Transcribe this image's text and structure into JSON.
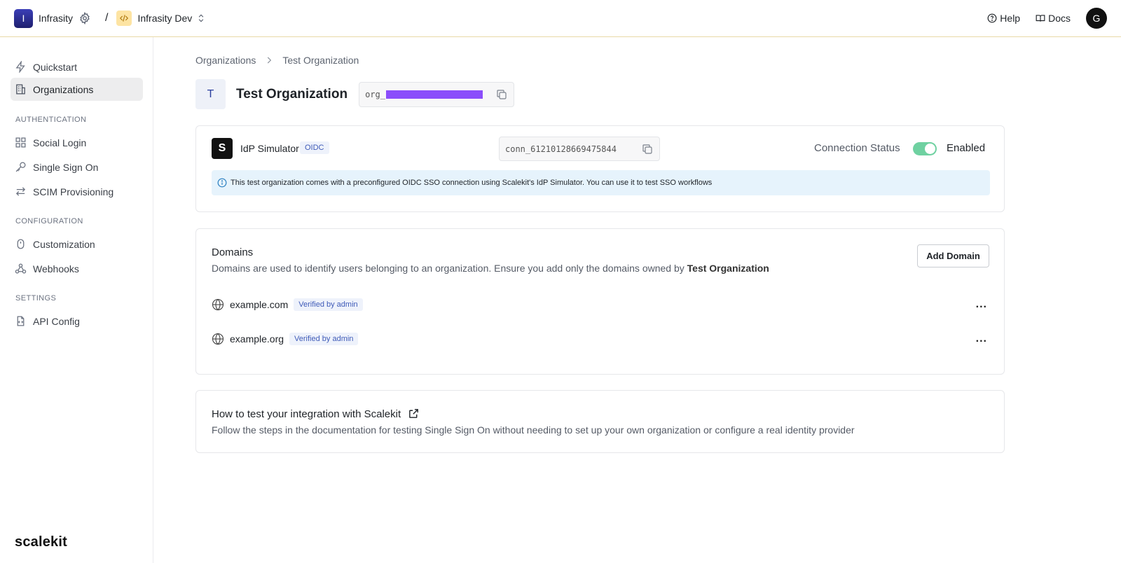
{
  "topbar": {
    "workspace_initial": "I",
    "workspace_name": "Infrasity",
    "separator": "/",
    "environment_name": "Infrasity Dev",
    "help_label": "Help",
    "docs_label": "Docs",
    "user_initial": "G"
  },
  "sidebar": {
    "items": [
      {
        "label": "Quickstart",
        "icon": "lightning-icon"
      },
      {
        "label": "Organizations",
        "icon": "building-icon",
        "active": true
      }
    ],
    "sections": [
      {
        "title": "AUTHENTICATION",
        "items": [
          {
            "label": "Social Login",
            "icon": "grid-icon"
          },
          {
            "label": "Single Sign On",
            "icon": "key-icon"
          },
          {
            "label": "SCIM Provisioning",
            "icon": "arrows-icon"
          }
        ]
      },
      {
        "title": "CONFIGURATION",
        "items": [
          {
            "label": "Customization",
            "icon": "mouse-icon"
          },
          {
            "label": "Webhooks",
            "icon": "webhook-icon"
          }
        ]
      },
      {
        "title": "SETTINGS",
        "items": [
          {
            "label": "API Config",
            "icon": "file-code-icon"
          }
        ]
      }
    ],
    "brand": "scalekit"
  },
  "breadcrumb": [
    "Organizations",
    "Test Organization"
  ],
  "organization": {
    "initial": "T",
    "name": "Test Organization",
    "id_prefix": "org_"
  },
  "connection": {
    "logo_letter": "S",
    "provider_name": "IdP Simulator",
    "protocol_badge": "OIDC",
    "connection_id": "conn_61210128669475844",
    "status_label": "Connection Status",
    "status_value": "Enabled",
    "enabled": true,
    "info_text": "This test organization comes with a preconfigured OIDC SSO connection using Scalekit's IdP Simulator. You can use it to test SSO workflows"
  },
  "domains": {
    "title": "Domains",
    "description": "Domains are used to identify users belonging to an organization. Ensure you add only the domains owned by",
    "description_org": "Test Organization",
    "add_button": "Add Domain",
    "items": [
      {
        "name": "example.com",
        "badge": "Verified by admin"
      },
      {
        "name": "example.org",
        "badge": "Verified by admin"
      }
    ],
    "more_label": "..."
  },
  "howto": {
    "title": "How to test your integration with Scalekit",
    "description": "Follow the steps in the documentation for testing Single Sign On without needing to set up your own organization or configure a real identity provider"
  },
  "colors": {
    "accent_toggle": "#6fd1a1",
    "badge_text": "#3f5bb8",
    "info_bg": "#e6f3fc",
    "redaction": "#8b4dfb"
  }
}
